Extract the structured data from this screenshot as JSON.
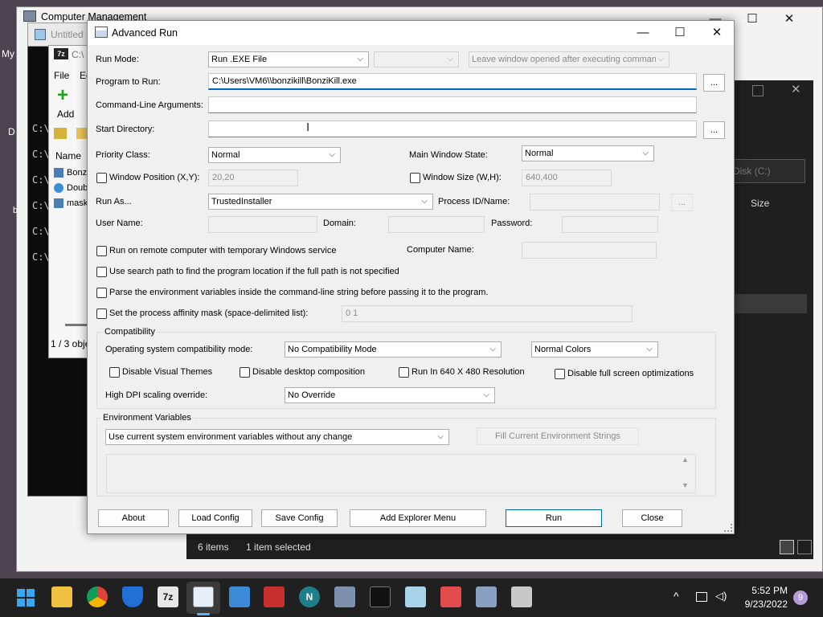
{
  "background_windows": {
    "computer_management": {
      "title": "Computer Management",
      "min": "—",
      "max": "☐",
      "close": "✕"
    },
    "notepad": {
      "title": "Untitled"
    },
    "my_label": "My",
    "d_label": "D",
    "b_label": "b",
    "sevenzip": {
      "title": "C:\\",
      "menu": [
        "File",
        "Ed"
      ],
      "add_label": "Add",
      "e_label": "E",
      "name_header": "Name",
      "files": [
        "Bonz",
        "Doub",
        "mask"
      ],
      "status": "1 / 3 obje"
    },
    "terminal_prompts": [
      "C:\\",
      "C:\\",
      "C:\\",
      "C:\\",
      "C:\\",
      "C:\\"
    ],
    "explorer": {
      "disk": "Disk (C:)",
      "size_header": "Size",
      "status_items": "6 items",
      "status_selected": "1 item selected"
    }
  },
  "dialog": {
    "title": "Advanced Run",
    "min": "—",
    "max": "☐",
    "close": "✕",
    "run_mode_label": "Run Mode:",
    "run_mode_value": "Run .EXE File",
    "run_mode_aux_value": "",
    "leave_window_value": "Leave window opened after executing comman",
    "program_label": "Program to Run:",
    "program_value": "C:\\Users\\VM6\\\\bonzikill\\BonziKill.exe",
    "browse": "...",
    "cmdline_label": "Command-Line Arguments:",
    "cmdline_value": "",
    "startdir_label": "Start Directory:",
    "startdir_value": "",
    "priority_label": "Priority Class:",
    "priority_value": "Normal",
    "mainwin_label": "Main Window State:",
    "mainwin_value": "Normal",
    "winpos_label": "Window Position (X,Y):",
    "winpos_value": "20,20",
    "winsize_label": "Window Size (W,H):",
    "winsize_value": "640,400",
    "runas_label": "Run As...",
    "runas_value": "TrustedInstaller",
    "pid_label": "Process ID/Name:",
    "pid_value": "",
    "username_label": "User Name:",
    "domain_label": "Domain:",
    "password_label": "Password:",
    "remote_label": "Run on remote computer with temporary Windows service",
    "computer_name_label": "Computer Name:",
    "search_path_label": "Use search path to find the program location if the full path is not specified",
    "parse_env_label": "Parse the environment variables inside the command-line string before passing it to the program.",
    "affinity_label": "Set the process affinity mask (space-delimited list):",
    "affinity_value": "0 1",
    "compat_group": "Compatibility",
    "os_compat_label": "Operating system compatibility mode:",
    "os_compat_value": "No Compatibility Mode",
    "colors_value": "Normal Colors",
    "disable_themes": "Disable Visual Themes",
    "disable_composition": "Disable desktop composition",
    "run_640": "Run In 640 X 480 Resolution",
    "disable_fso": "Disable full screen optimizations",
    "dpi_label": "High DPI scaling override:",
    "dpi_value": "No Override",
    "env_group": "Environment Variables",
    "env_mode_value": "Use current system environment variables without any change",
    "fill_env_button": "Fill Current Environment Strings",
    "buttons": {
      "about": "About",
      "load": "Load Config",
      "save": "Save Config",
      "explorer_menu": "Add Explorer Menu",
      "run": "Run",
      "close": "Close"
    }
  },
  "taskbar": {
    "time": "5:52 PM",
    "date": "9/23/2022",
    "notification_count": "9",
    "sevenzip_label": "7z",
    "chevron": "^"
  }
}
